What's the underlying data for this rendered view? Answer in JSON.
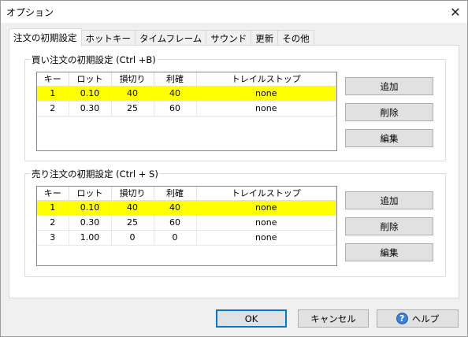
{
  "window": {
    "title": "オプション"
  },
  "tabs": [
    {
      "label": "注文の初期設定"
    },
    {
      "label": "ホットキー"
    },
    {
      "label": "タイムフレーム"
    },
    {
      "label": "サウンド"
    },
    {
      "label": "更新"
    },
    {
      "label": "その他"
    }
  ],
  "buy_group": {
    "title": "買い注文の初期設定 (Ctrl +B)",
    "columns": [
      "キー",
      "ロット",
      "損切り",
      "利確",
      "トレイルストップ"
    ],
    "rows": [
      {
        "key": "1",
        "lot": "0.10",
        "stop": "40",
        "profit": "40",
        "trail": "none",
        "selected": true
      },
      {
        "key": "2",
        "lot": "0.30",
        "stop": "25",
        "profit": "60",
        "trail": "none",
        "selected": false
      }
    ],
    "buttons": {
      "add": "追加",
      "delete": "削除",
      "edit": "編集"
    }
  },
  "sell_group": {
    "title": "売り注文の初期設定 (Ctrl + S)",
    "columns": [
      "キー",
      "ロット",
      "損切り",
      "利確",
      "トレイルストップ"
    ],
    "rows": [
      {
        "key": "1",
        "lot": "0.10",
        "stop": "40",
        "profit": "40",
        "trail": "none",
        "selected": true
      },
      {
        "key": "2",
        "lot": "0.30",
        "stop": "25",
        "profit": "60",
        "trail": "none",
        "selected": false
      },
      {
        "key": "3",
        "lot": "1.00",
        "stop": "0",
        "profit": "0",
        "trail": "none",
        "selected": false
      }
    ],
    "buttons": {
      "add": "追加",
      "delete": "削除",
      "edit": "編集"
    }
  },
  "footer": {
    "ok": "OK",
    "cancel": "キャンセル",
    "help": "ヘルプ"
  },
  "colors": {
    "selected_row": "#ffff00",
    "default_button_border": "#0078d7"
  }
}
